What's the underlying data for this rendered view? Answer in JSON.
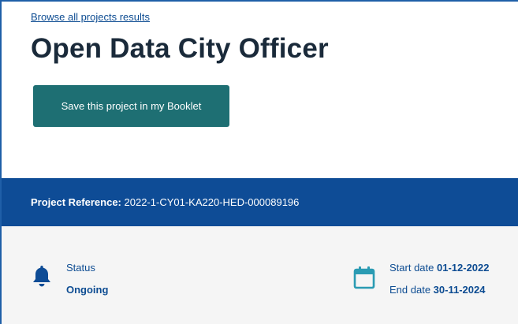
{
  "breadcrumb": {
    "link_text": "Browse all projects results"
  },
  "project": {
    "title": "Open Data City Officer",
    "save_label": "Save this project in my Booklet",
    "reference_label": "Project Reference:",
    "reference_value": "2022-1-CY01-KA220-HED-000089196"
  },
  "info": {
    "status_label": "Status",
    "status_value": "Ongoing",
    "start_label": "Start date",
    "start_value": "01-12-2022",
    "end_label": "End date",
    "end_value": "30-11-2024"
  },
  "icons": {
    "status": "bell-icon",
    "dates": "calendar-icon"
  },
  "colors": {
    "primary_blue": "#0e4c96",
    "button_teal": "#1e6f73",
    "link_blue": "#0d4c92",
    "title_dark": "#1a2a3a",
    "info_bg": "#f5f5f5",
    "icon_blue": "#0e4c96",
    "calendar_teal": "#2a9bb3"
  }
}
